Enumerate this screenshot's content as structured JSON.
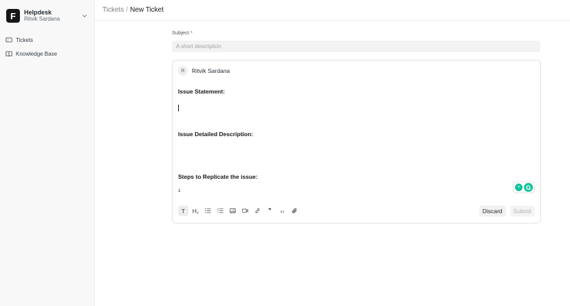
{
  "sidebar": {
    "brand": {
      "logo_letter": "F",
      "title": "Helpdesk",
      "user": "Ritvik Sardana",
      "chevron_icon": "chevron-down-icon"
    },
    "items": [
      {
        "label": "Tickets",
        "icon": "ticket-icon"
      },
      {
        "label": "Knowledge Base",
        "icon": "book-icon"
      }
    ]
  },
  "header": {
    "breadcrumb_parent": "Tickets",
    "breadcrumb_separator": "/",
    "breadcrumb_current": "New Ticket"
  },
  "form": {
    "subject_label": "Subject",
    "required_marker": "*",
    "subject_placeholder": "A short description",
    "subject_value": ""
  },
  "editor": {
    "author_initial": "R",
    "author_name": "Ritvik Sardana",
    "heading_statement": "Issue Statement:",
    "heading_description": "Issue Detailed Description:",
    "heading_steps": "Steps to Replicate the issue:",
    "list_start": "1"
  },
  "toolbar": {
    "tools": [
      "text-icon",
      "heading-icon",
      "bullet-list-icon",
      "numbered-list-icon",
      "image-icon",
      "video-icon",
      "link-icon",
      "quote-icon",
      "code-icon",
      "attachment-icon"
    ],
    "text_glyph": "T",
    "heading_glyph": "H₂",
    "quote_glyph": "❞",
    "code_glyph": "‹›"
  },
  "actions": {
    "discard_label": "Discard",
    "submit_label": "Submit"
  },
  "colors": {
    "brand_dark": "#171717",
    "required": "#e03636",
    "grammarly": "#15c39a"
  }
}
